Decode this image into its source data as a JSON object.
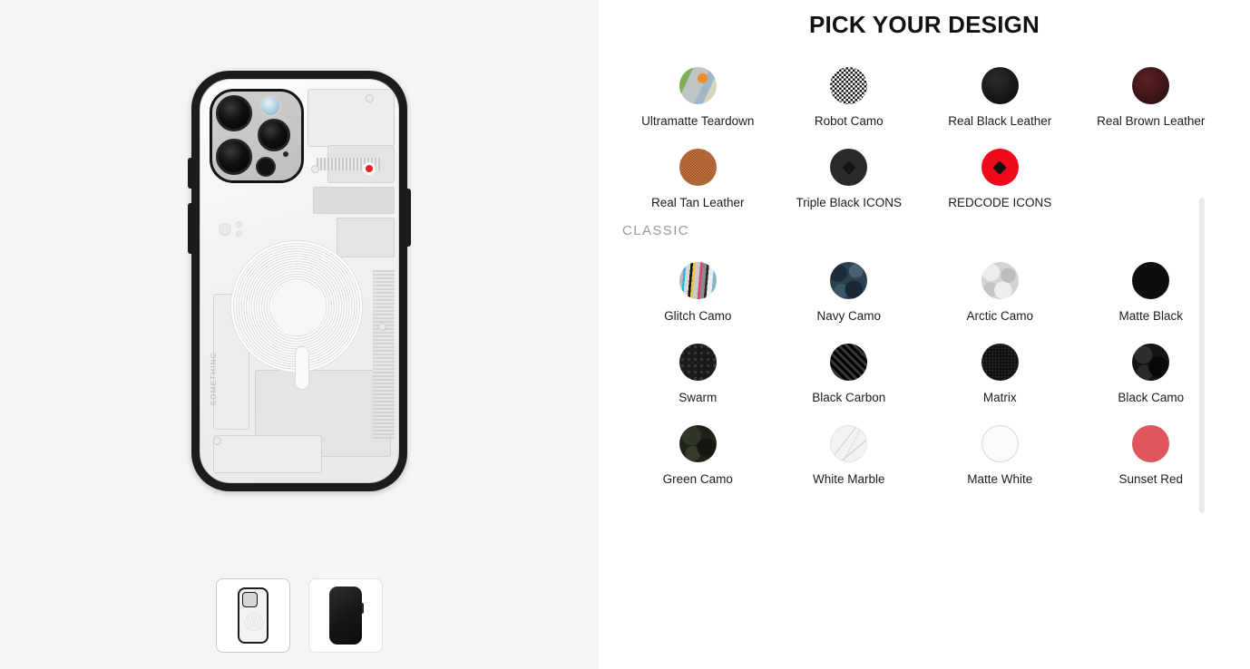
{
  "gallery": {
    "hero": {
      "alt": "Ultramatte Teardown phone case back view",
      "brand_text": "SOMETHING"
    },
    "thumbnails": [
      {
        "name": "case-back-view",
        "selected": true
      },
      {
        "name": "case-front-view",
        "selected": false
      }
    ]
  },
  "picker": {
    "title": "PICK YOUR DESIGN",
    "groups": [
      {
        "heading": "",
        "swatches": [
          {
            "label": "Ultramatte Teardown",
            "finish": "sw-teardown",
            "icon": false
          },
          {
            "label": "Robot Camo",
            "finish": "sw-robotcamo",
            "icon": false
          },
          {
            "label": "Real Black Leather",
            "finish": "sw-blackleather",
            "icon": false
          },
          {
            "label": "Real Brown Leather",
            "finish": "sw-brownleather",
            "icon": false
          },
          {
            "label": "Real Tan Leather",
            "finish": "sw-tanleather",
            "icon": false
          },
          {
            "label": "Triple Black ICONS",
            "finish": "sw-tripleblack",
            "icon": true
          },
          {
            "label": "REDCODE ICONS",
            "finish": "sw-redcode",
            "icon": true
          }
        ]
      },
      {
        "heading": "CLASSIC",
        "swatches": [
          {
            "label": "Glitch Camo",
            "finish": "sw-glitchcamo",
            "icon": false
          },
          {
            "label": "Navy Camo",
            "finish": "sw-navycamo",
            "icon": false
          },
          {
            "label": "Arctic Camo",
            "finish": "sw-arcticcamo",
            "icon": false
          },
          {
            "label": "Matte Black",
            "finish": "sw-matteblack",
            "icon": false
          },
          {
            "label": "Swarm",
            "finish": "sw-swarm",
            "icon": false
          },
          {
            "label": "Black Carbon",
            "finish": "sw-blackcarbon",
            "icon": false
          },
          {
            "label": "Matrix",
            "finish": "sw-matrix",
            "icon": false
          },
          {
            "label": "Black Camo",
            "finish": "sw-blackcamo",
            "icon": false
          },
          {
            "label": "Green Camo",
            "finish": "sw-greencamo",
            "icon": false
          },
          {
            "label": "White Marble",
            "finish": "sw-whitemarble",
            "icon": false
          },
          {
            "label": "Matte White",
            "finish": "sw-mattewhite",
            "icon": false
          },
          {
            "label": "Sunset Red",
            "finish": "sw-sunsetred",
            "icon": false
          }
        ]
      }
    ],
    "colors": {
      "redcode": "#ee0a1a",
      "sunset_red": "#e0565f",
      "navy_camo": "#2d4050",
      "tan_leather": "#c2652f",
      "brown_leather": "#3c1317",
      "heading_gray": "#9a9a9a",
      "panel_gray": "#f5f5f5",
      "scrollbar": "#e8eaed"
    }
  }
}
